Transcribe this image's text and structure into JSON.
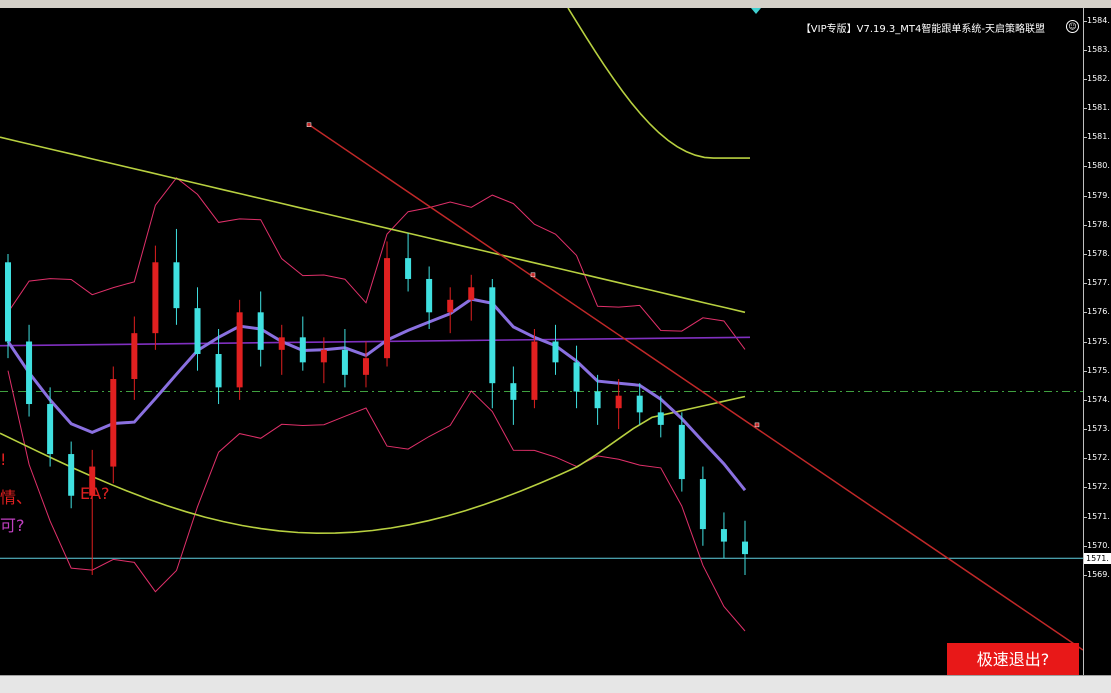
{
  "window": {
    "title": "【VIP专版】V7.19.3_MT4智能跟单系统-天启策略联盟"
  },
  "buttons": {
    "exit_label": "极速退出?"
  },
  "overlay_text": [
    {
      "text": "!",
      "color": "#e02020"
    },
    {
      "text": "情、",
      "color": "#e02020"
    },
    {
      "text": "EA?",
      "color": "#e02020"
    },
    {
      "text": "可?",
      "color": "#c040c0"
    }
  ],
  "chart_data": {
    "type": "candlestick",
    "title": "",
    "xlabel": "",
    "ylabel": "",
    "ylim": [
      1568.6,
      1584.6
    ],
    "y_ticks": [
      "1584.",
      "1583.",
      "1582.",
      "1581.",
      "1581.",
      "1580.",
      "1579.",
      "1578.",
      "1578.",
      "1577.",
      "1576.",
      "1575.",
      "1575.",
      "1574.",
      "1573.",
      "1572.",
      "1572.",
      "1571.",
      "1570.",
      "1569."
    ],
    "y_tick_values": [
      1584.3,
      1583.6,
      1582.9,
      1582.2,
      1581.5,
      1580.8,
      1580.1,
      1579.4,
      1578.7,
      1578.0,
      1577.3,
      1576.6,
      1575.9,
      1575.2,
      1574.5,
      1573.8,
      1573.1,
      1572.4,
      1571.7,
      1571.0
    ],
    "current_price": {
      "label": "1571.",
      "value": 1571.4
    },
    "dashed_level": 1575.4,
    "colors": {
      "up_candle": "#e02020",
      "down_candle": "#40e0e0",
      "ma_slow": "#b8d040",
      "ma_mid": "#8a70e0",
      "ma_long": "#8030c0",
      "bollinger": "#e0306a",
      "trendline": "#c02828",
      "current_line": "#60d0e0",
      "dashed_line": "#40a040"
    },
    "candles": [
      [
        1578.5,
        1578.7,
        1576.2,
        1576.6
      ],
      [
        1576.6,
        1577.0,
        1574.8,
        1575.1
      ],
      [
        1575.1,
        1575.5,
        1573.6,
        1573.9
      ],
      [
        1573.9,
        1574.2,
        1572.6,
        1572.9
      ],
      [
        1572.9,
        1574.0,
        1571.0,
        1573.6
      ],
      [
        1573.6,
        1576.0,
        1573.2,
        1575.7
      ],
      [
        1575.7,
        1577.2,
        1575.2,
        1576.8
      ],
      [
        1576.8,
        1578.9,
        1576.4,
        1578.5
      ],
      [
        1578.5,
        1579.3,
        1577.0,
        1577.4
      ],
      [
        1577.4,
        1577.9,
        1575.9,
        1576.3
      ],
      [
        1576.3,
        1576.9,
        1575.1,
        1575.5
      ],
      [
        1575.5,
        1577.6,
        1575.2,
        1577.3
      ],
      [
        1577.3,
        1577.8,
        1576.0,
        1576.4
      ],
      [
        1576.4,
        1577.0,
        1575.8,
        1576.7
      ],
      [
        1576.7,
        1577.2,
        1575.9,
        1576.1
      ],
      [
        1576.1,
        1576.7,
        1575.6,
        1576.4
      ],
      [
        1576.4,
        1576.9,
        1575.5,
        1575.8
      ],
      [
        1575.8,
        1576.6,
        1575.5,
        1576.2
      ],
      [
        1576.2,
        1579.0,
        1576.0,
        1578.6
      ],
      [
        1578.6,
        1579.2,
        1577.8,
        1578.1
      ],
      [
        1578.1,
        1578.4,
        1576.9,
        1577.3
      ],
      [
        1577.3,
        1577.9,
        1576.8,
        1577.6
      ],
      [
        1577.6,
        1578.2,
        1577.1,
        1577.9
      ],
      [
        1577.9,
        1578.1,
        1575.0,
        1575.6
      ],
      [
        1575.6,
        1576.0,
        1574.6,
        1575.2
      ],
      [
        1575.2,
        1576.9,
        1575.0,
        1576.6
      ],
      [
        1576.6,
        1577.0,
        1575.8,
        1576.1
      ],
      [
        1576.1,
        1576.5,
        1575.0,
        1575.4
      ],
      [
        1575.4,
        1575.8,
        1574.6,
        1575.0
      ],
      [
        1575.0,
        1575.7,
        1574.5,
        1575.3
      ],
      [
        1575.3,
        1575.6,
        1574.6,
        1574.9
      ],
      [
        1574.9,
        1575.3,
        1574.3,
        1574.6
      ],
      [
        1574.6,
        1574.9,
        1573.0,
        1573.3
      ],
      [
        1573.3,
        1573.6,
        1571.7,
        1572.1
      ],
      [
        1572.1,
        1572.5,
        1571.4,
        1571.8
      ],
      [
        1571.8,
        1572.3,
        1571.0,
        1571.5
      ]
    ]
  }
}
